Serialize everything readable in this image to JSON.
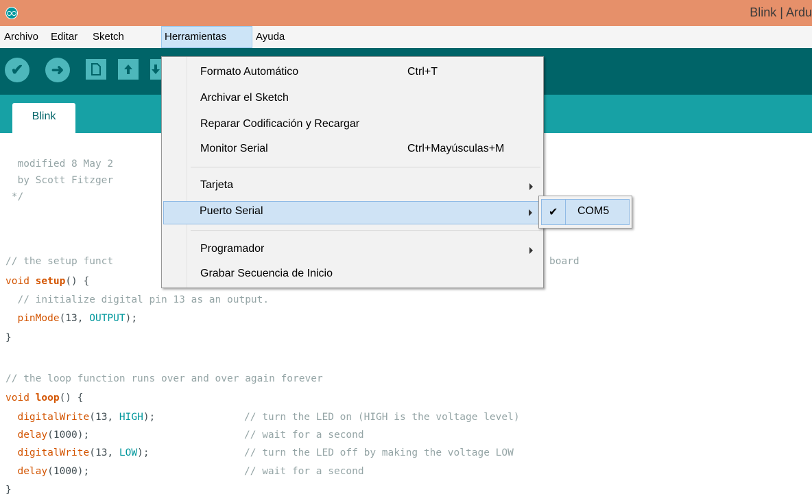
{
  "window": {
    "title": "Blink | Ardu"
  },
  "menubar": {
    "items": [
      {
        "label": "Archivo"
      },
      {
        "label": "Editar"
      },
      {
        "label": "Sketch"
      },
      {
        "label": "Herramientas"
      },
      {
        "label": "Ayuda"
      }
    ]
  },
  "toolbar": {
    "verify_icon": "✔",
    "upload_icon": "➜",
    "new_icon": "new-file-icon",
    "open_icon": "open-icon",
    "save_icon": "save-icon"
  },
  "tabs": [
    {
      "label": "Blink"
    }
  ],
  "menu": {
    "items": [
      {
        "label": "Formato Automático",
        "shortcut": "Ctrl+T"
      },
      {
        "label": "Archivar el Sketch"
      },
      {
        "label": "Reparar Codificación y Recargar"
      },
      {
        "label": "Monitor Serial",
        "shortcut": "Ctrl+Mayúsculas+M"
      },
      {
        "label": "Tarjeta"
      },
      {
        "label": "Puerto Serial"
      },
      {
        "label": "Programador"
      },
      {
        "label": "Grabar Secuencia de Inicio"
      }
    ]
  },
  "submenu": {
    "check": "✔",
    "port": "COM5"
  },
  "code": {
    "l1": "  modified 8 May 2",
    "l2": "  by Scott Fitzger",
    "l3": " */",
    "l4a": "// the setup funct",
    "l4b": "board",
    "l5a": "void",
    "l5b": "setup",
    "l5c": "() {",
    "l6": "  // initialize digital pin 13 as an output.",
    "l7a": "pinMode",
    "l7b": "(13, ",
    "l7c": "OUTPUT",
    "l7d": ");",
    "l8": "}",
    "l9": "// the loop function runs over and over again forever",
    "l10a": "void",
    "l10b": "loop",
    "l10c": "() {",
    "l11a": "digitalWrite",
    "l11b": "(13, ",
    "l11c": "HIGH",
    "l11d": ");",
    "l11e": "// turn the LED on (HIGH is the voltage level)",
    "l12a": "delay",
    "l12b": "(1000);",
    "l12e": "// wait for a second",
    "l13a": "digitalWrite",
    "l13b": "(13, ",
    "l13c": "LOW",
    "l13d": ");",
    "l13e": "// turn the LED off by making the voltage LOW",
    "l14a": "delay",
    "l14b": "(1000);",
    "l14e": "// wait for a second",
    "l15": "}"
  }
}
